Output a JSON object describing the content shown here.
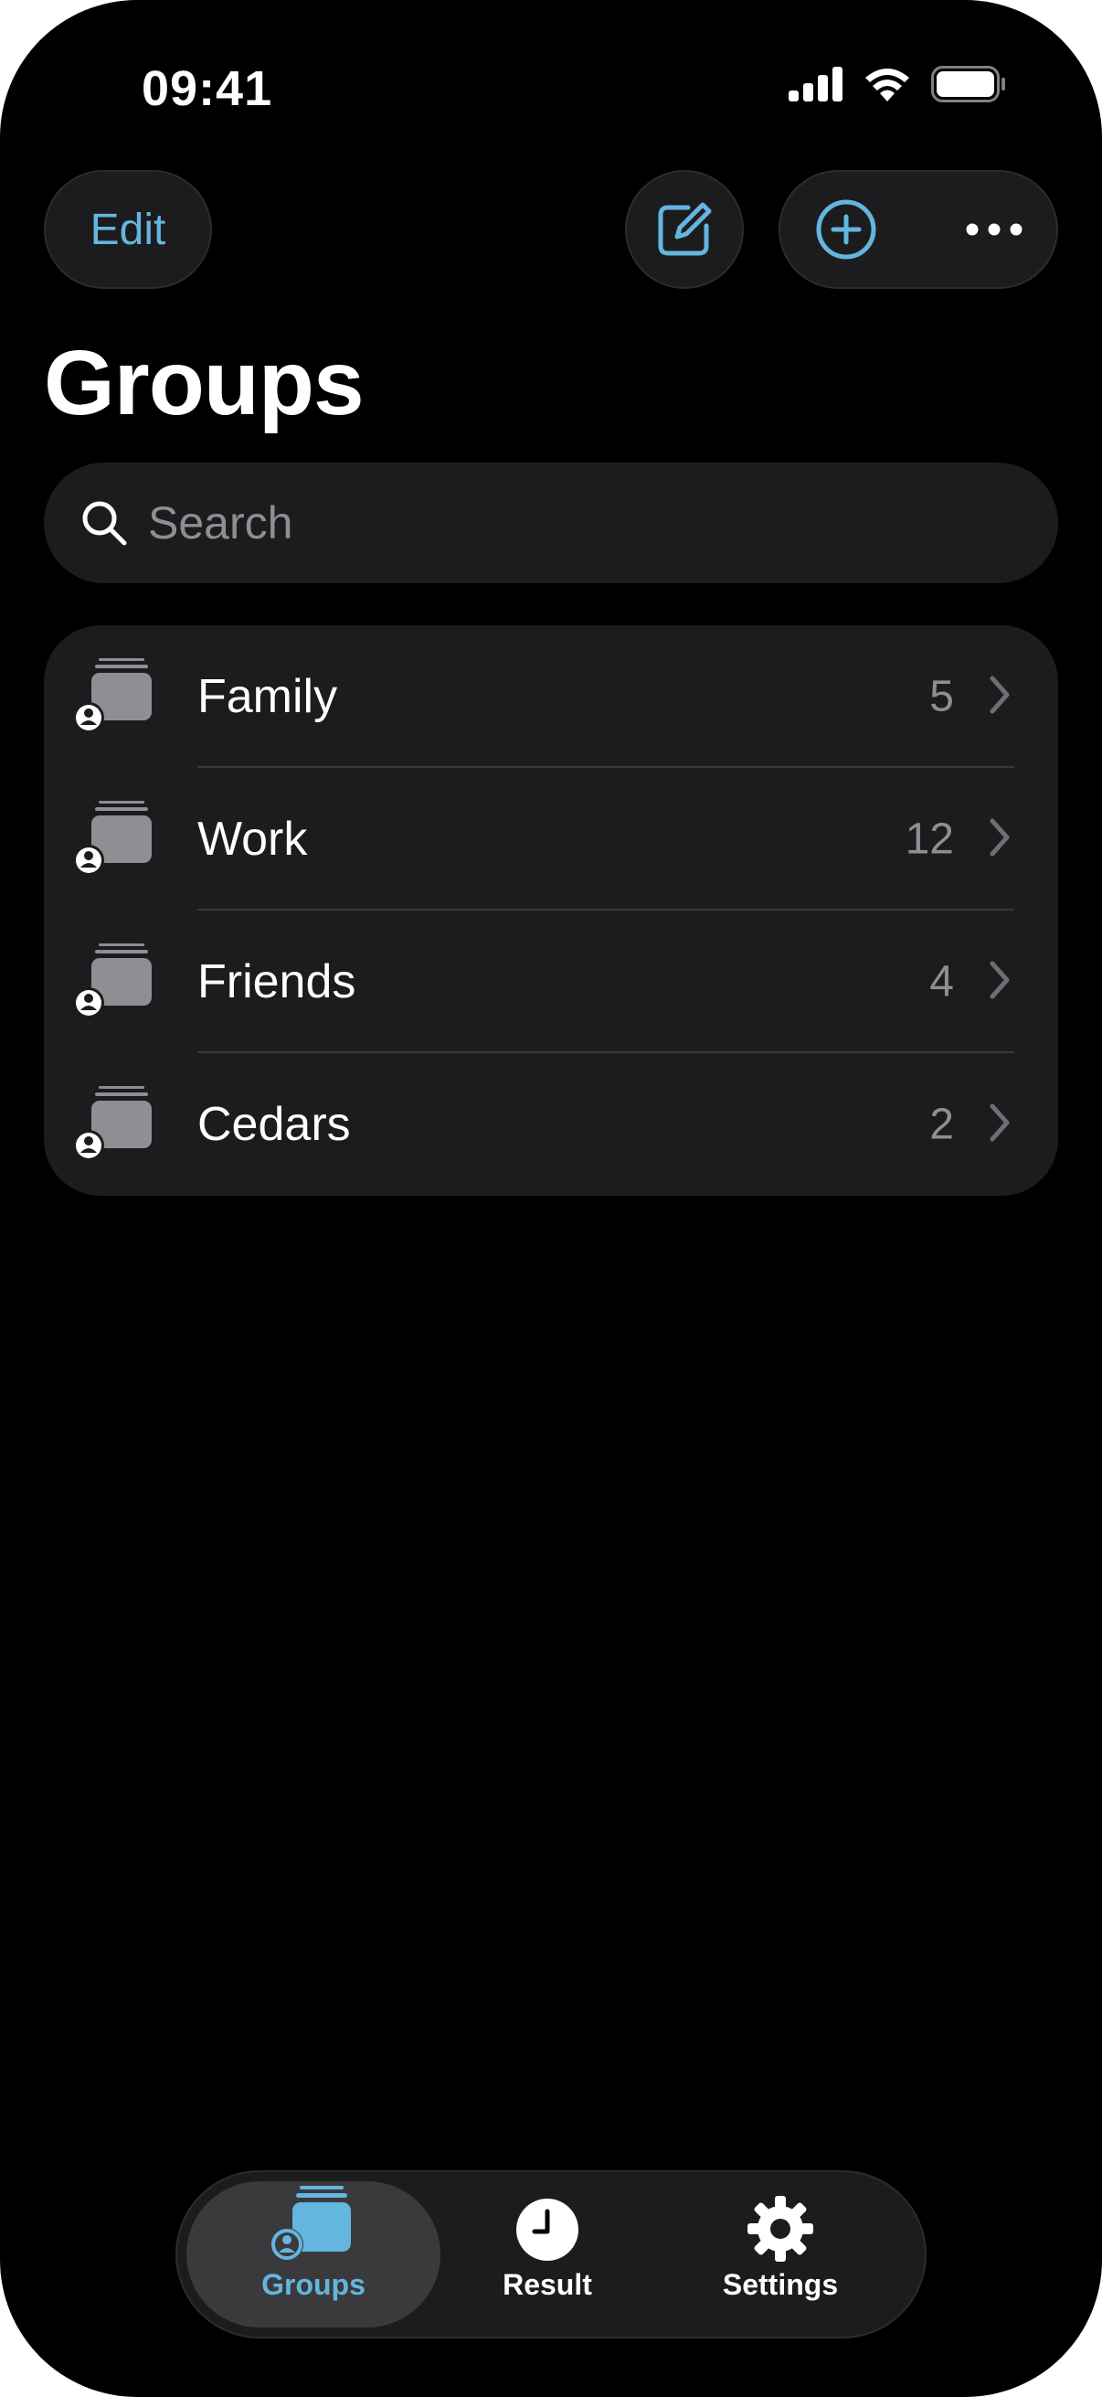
{
  "status_bar": {
    "time": "09:41"
  },
  "toolbar": {
    "edit_label": "Edit",
    "compose_icon": "square-and-pencil-icon",
    "add_icon": "plus-circle-icon",
    "more_icon": "ellipsis-icon"
  },
  "page": {
    "title": "Groups"
  },
  "search": {
    "placeholder": "Search",
    "value": ""
  },
  "groups": [
    {
      "name": "Family",
      "count": "5"
    },
    {
      "name": "Work",
      "count": "12"
    },
    {
      "name": "Friends",
      "count": "4"
    },
    {
      "name": "Cedars",
      "count": "2"
    }
  ],
  "tabbar": {
    "tabs": [
      {
        "label": "Groups",
        "icon": "groups-stack-icon",
        "selected": true
      },
      {
        "label": "Result",
        "icon": "clock-icon",
        "selected": false
      },
      {
        "label": "Settings",
        "icon": "gear-icon",
        "selected": false
      }
    ]
  },
  "colors": {
    "accent": "#64b5e0",
    "background": "#000000",
    "surface": "#1c1c1e",
    "secondary_text": "#8e8e93"
  }
}
